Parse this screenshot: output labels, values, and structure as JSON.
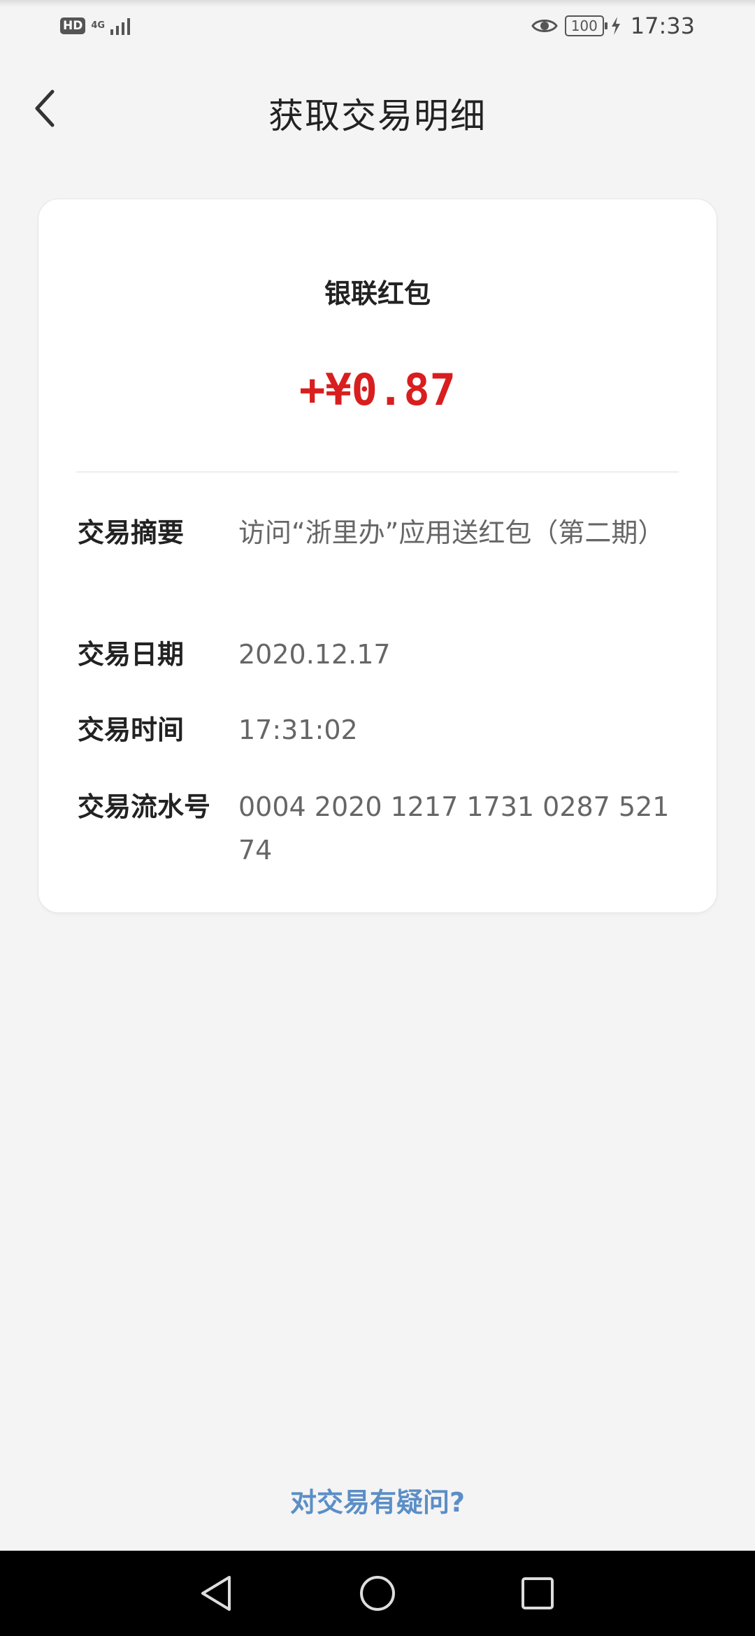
{
  "status_bar": {
    "hd_label": "HD",
    "network_type": "4G",
    "battery_level": "100",
    "time": "17:33",
    "icons": [
      "signal-icon",
      "eye-icon",
      "battery-icon",
      "charging-icon"
    ]
  },
  "header": {
    "title": "获取交易明细",
    "back_icon": "chevron-left-icon"
  },
  "transaction": {
    "merchant": "银联红包",
    "amount": "+¥0.87",
    "amount_color": "#d81e1e",
    "rows": [
      {
        "label": "交易摘要",
        "value": "访问“浙里办”应用送红包（第二期）"
      },
      {
        "label": "交易日期",
        "value": "2020.12.17"
      },
      {
        "label": "交易时间",
        "value": "17:31:02"
      },
      {
        "label": "交易流水号",
        "value": "0004 2020 1217 1731 0287 52174"
      }
    ]
  },
  "query_link": {
    "label": "对交易有疑问?",
    "color": "#5b8ec6"
  },
  "nav_bar": {
    "icons": [
      "nav-back-icon",
      "nav-home-icon",
      "nav-recent-apps-icon"
    ]
  }
}
